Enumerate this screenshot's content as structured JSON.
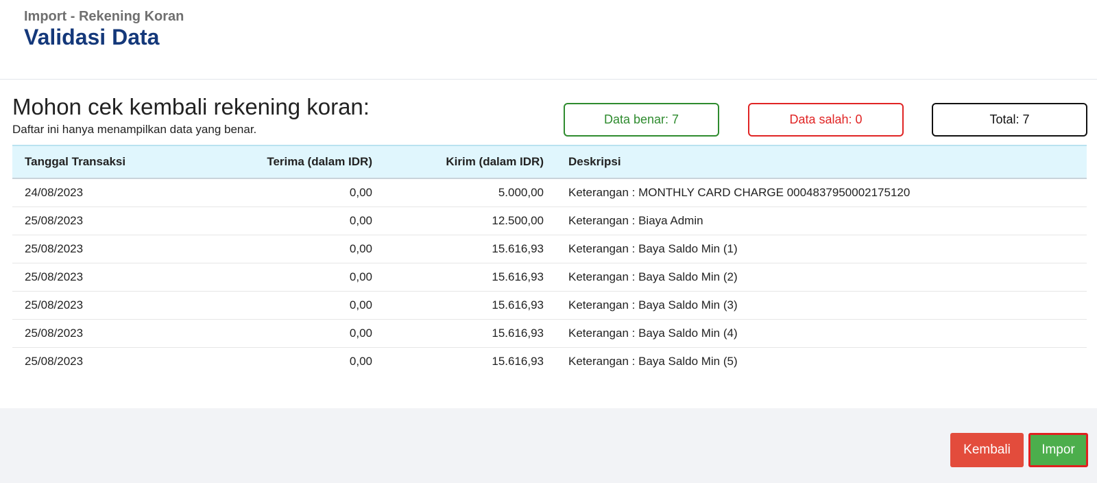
{
  "header": {
    "breadcrumb": "Import - Rekening Koran",
    "title": "Validasi Data"
  },
  "content": {
    "heading": "Mohon cek kembali rekening koran:",
    "subheading": "Daftar ini hanya menampilkan data yang benar."
  },
  "stats": {
    "valid": "Data benar: 7",
    "invalid": "Data salah: 0",
    "total": "Total: 7",
    "colors": {
      "valid": "#2e8b2e",
      "invalid": "#e02424",
      "total": "#111111"
    }
  },
  "table": {
    "headers": {
      "date": "Tanggal Transaksi",
      "received": "Terima (dalam IDR)",
      "sent": "Kirim (dalam IDR)",
      "description": "Deskripsi"
    },
    "rows": [
      {
        "date": "24/08/2023",
        "received": "0,00",
        "sent": "5.000,00",
        "description": "Keterangan : MONTHLY CARD CHARGE 0004837950002175120"
      },
      {
        "date": "25/08/2023",
        "received": "0,00",
        "sent": "12.500,00",
        "description": "Keterangan : Biaya Admin"
      },
      {
        "date": "25/08/2023",
        "received": "0,00",
        "sent": "15.616,93",
        "description": "Keterangan : Baya Saldo Min (1)"
      },
      {
        "date": "25/08/2023",
        "received": "0,00",
        "sent": "15.616,93",
        "description": "Keterangan : Baya Saldo Min (2)"
      },
      {
        "date": "25/08/2023",
        "received": "0,00",
        "sent": "15.616,93",
        "description": "Keterangan : Baya Saldo Min (3)"
      },
      {
        "date": "25/08/2023",
        "received": "0,00",
        "sent": "15.616,93",
        "description": "Keterangan : Baya Saldo Min (4)"
      },
      {
        "date": "25/08/2023",
        "received": "0,00",
        "sent": "15.616,93",
        "description": "Keterangan : Baya Saldo Min (5)"
      }
    ]
  },
  "footer": {
    "back_label": "Kembali",
    "import_label": "Impor"
  }
}
